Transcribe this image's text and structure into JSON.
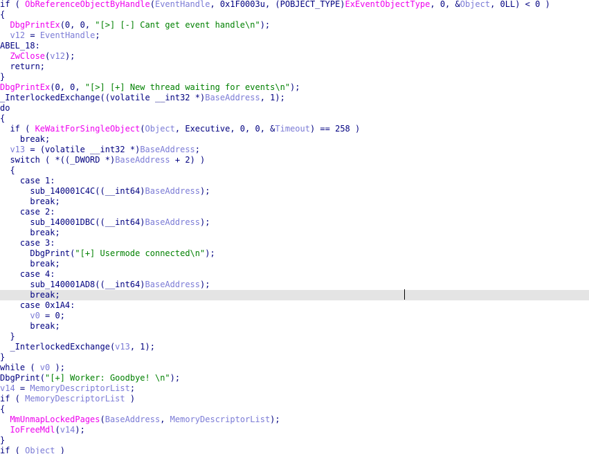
{
  "colors": {
    "keyword": "#000080",
    "function": "#ee00ee",
    "variable": "#7b7bd6",
    "string": "#008000",
    "highlight": "#e4e4e4",
    "background": "#ffffff"
  },
  "code": {
    "highlighted_line": 28,
    "lines": [
      [
        [
          "kw",
          "if ( "
        ],
        [
          "func",
          "ObReferenceObjectByHandle"
        ],
        [
          "punc",
          "("
        ],
        [
          "var",
          "EventHandle"
        ],
        [
          "punc",
          ", 0x1F0003u, (POBJECT_TYPE)"
        ],
        [
          "func",
          "ExEventObjectType"
        ],
        [
          "punc",
          ", 0, &"
        ],
        [
          "var",
          "Object"
        ],
        [
          "punc",
          ", 0LL) < 0 )"
        ]
      ],
      [
        [
          "punc",
          "{"
        ]
      ],
      [
        [
          "punc",
          "  "
        ],
        [
          "func",
          "DbgPrintEx"
        ],
        [
          "punc",
          "(0, 0, "
        ],
        [
          "str",
          "\"[>] [-] Cant get event handle\\n\""
        ],
        [
          "punc",
          ");"
        ]
      ],
      [
        [
          "punc",
          "  "
        ],
        [
          "var",
          "v12"
        ],
        [
          "punc",
          " = "
        ],
        [
          "var",
          "EventHandle"
        ],
        [
          "punc",
          ";"
        ]
      ],
      [
        [
          "plain",
          "ABEL_18:"
        ]
      ],
      [
        [
          "punc",
          "  "
        ],
        [
          "func",
          "ZwClose"
        ],
        [
          "punc",
          "("
        ],
        [
          "var",
          "v12"
        ],
        [
          "punc",
          ");"
        ]
      ],
      [
        [
          "kw",
          "  return;"
        ]
      ],
      [
        [
          "punc",
          "}"
        ]
      ],
      [
        [
          "func",
          "DbgPrintEx"
        ],
        [
          "punc",
          "(0, 0, "
        ],
        [
          "str",
          "\"[>] [+] New thread waiting for events\\n\""
        ],
        [
          "punc",
          ");"
        ]
      ],
      [
        [
          "plain",
          "_InterlockedExchange((volatile __int32 *)"
        ],
        [
          "var",
          "BaseAddress"
        ],
        [
          "punc",
          ", 1);"
        ]
      ],
      [
        [
          "kw",
          "do"
        ]
      ],
      [
        [
          "punc",
          "{"
        ]
      ],
      [
        [
          "kw",
          "  if ( "
        ],
        [
          "func",
          "KeWaitForSingleObject"
        ],
        [
          "punc",
          "("
        ],
        [
          "var",
          "Object"
        ],
        [
          "punc",
          ", Executive, 0, 0, &"
        ],
        [
          "var",
          "Timeout"
        ],
        [
          "punc",
          ") == 258 )"
        ]
      ],
      [
        [
          "kw",
          "    break;"
        ]
      ],
      [
        [
          "punc",
          "  "
        ],
        [
          "var",
          "v13"
        ],
        [
          "punc",
          " = (volatile __int32 *)"
        ],
        [
          "var",
          "BaseAddress"
        ],
        [
          "punc",
          ";"
        ]
      ],
      [
        [
          "kw",
          "  switch ( "
        ],
        [
          "punc",
          "*((_DWORD *)"
        ],
        [
          "var",
          "BaseAddress"
        ],
        [
          "punc",
          " + 2) )"
        ]
      ],
      [
        [
          "punc",
          "  {"
        ]
      ],
      [
        [
          "kw",
          "    case 1:"
        ]
      ],
      [
        [
          "plain",
          "      sub_140001C4C((__int64)"
        ],
        [
          "var",
          "BaseAddress"
        ],
        [
          "punc",
          ");"
        ]
      ],
      [
        [
          "kw",
          "      break;"
        ]
      ],
      [
        [
          "kw",
          "    case 2:"
        ]
      ],
      [
        [
          "plain",
          "      sub_140001DBC((__int64)"
        ],
        [
          "var",
          "BaseAddress"
        ],
        [
          "punc",
          ");"
        ]
      ],
      [
        [
          "kw",
          "      break;"
        ]
      ],
      [
        [
          "kw",
          "    case 3:"
        ]
      ],
      [
        [
          "plain",
          "      DbgPrint("
        ],
        [
          "str",
          "\"[+] Usermode connected\\n\""
        ],
        [
          "punc",
          ");"
        ]
      ],
      [
        [
          "kw",
          "      break;"
        ]
      ],
      [
        [
          "kw",
          "    case 4:"
        ]
      ],
      [
        [
          "plain",
          "      sub_140001AD8((__int64)"
        ],
        [
          "var",
          "BaseAddress"
        ],
        [
          "punc",
          ");"
        ]
      ],
      [
        [
          "kw",
          "      break;"
        ]
      ],
      [
        [
          "kw",
          "    case 0x1A4:"
        ]
      ],
      [
        [
          "punc",
          "      "
        ],
        [
          "var",
          "v0"
        ],
        [
          "punc",
          " = 0;"
        ]
      ],
      [
        [
          "kw",
          "      break;"
        ]
      ],
      [
        [
          "punc",
          "  }"
        ]
      ],
      [
        [
          "plain",
          "  _InterlockedExchange("
        ],
        [
          "var",
          "v13"
        ],
        [
          "punc",
          ", 1);"
        ]
      ],
      [
        [
          "punc",
          "}"
        ]
      ],
      [
        [
          "kw",
          "while ( "
        ],
        [
          "var",
          "v0"
        ],
        [
          "punc",
          " );"
        ]
      ],
      [
        [
          "plain",
          "DbgPrint("
        ],
        [
          "str",
          "\"[+] Worker: Goodbye! \\n\""
        ],
        [
          "punc",
          ");"
        ]
      ],
      [
        [
          "var",
          "v14"
        ],
        [
          "punc",
          " = "
        ],
        [
          "var",
          "MemoryDescriptorList"
        ],
        [
          "punc",
          ";"
        ]
      ],
      [
        [
          "kw",
          "if ( "
        ],
        [
          "var",
          "MemoryDescriptorList"
        ],
        [
          "punc",
          " )"
        ]
      ],
      [
        [
          "punc",
          "{"
        ]
      ],
      [
        [
          "punc",
          "  "
        ],
        [
          "func",
          "MmUnmapLockedPages"
        ],
        [
          "punc",
          "("
        ],
        [
          "var",
          "BaseAddress"
        ],
        [
          "punc",
          ", "
        ],
        [
          "var",
          "MemoryDescriptorList"
        ],
        [
          "punc",
          ");"
        ]
      ],
      [
        [
          "punc",
          "  "
        ],
        [
          "func",
          "IoFreeMdl"
        ],
        [
          "punc",
          "("
        ],
        [
          "var",
          "v14"
        ],
        [
          "punc",
          ");"
        ]
      ],
      [
        [
          "punc",
          "}"
        ]
      ],
      [
        [
          "kw",
          "if ( "
        ],
        [
          "var",
          "Object"
        ],
        [
          "punc",
          " )"
        ]
      ]
    ]
  }
}
